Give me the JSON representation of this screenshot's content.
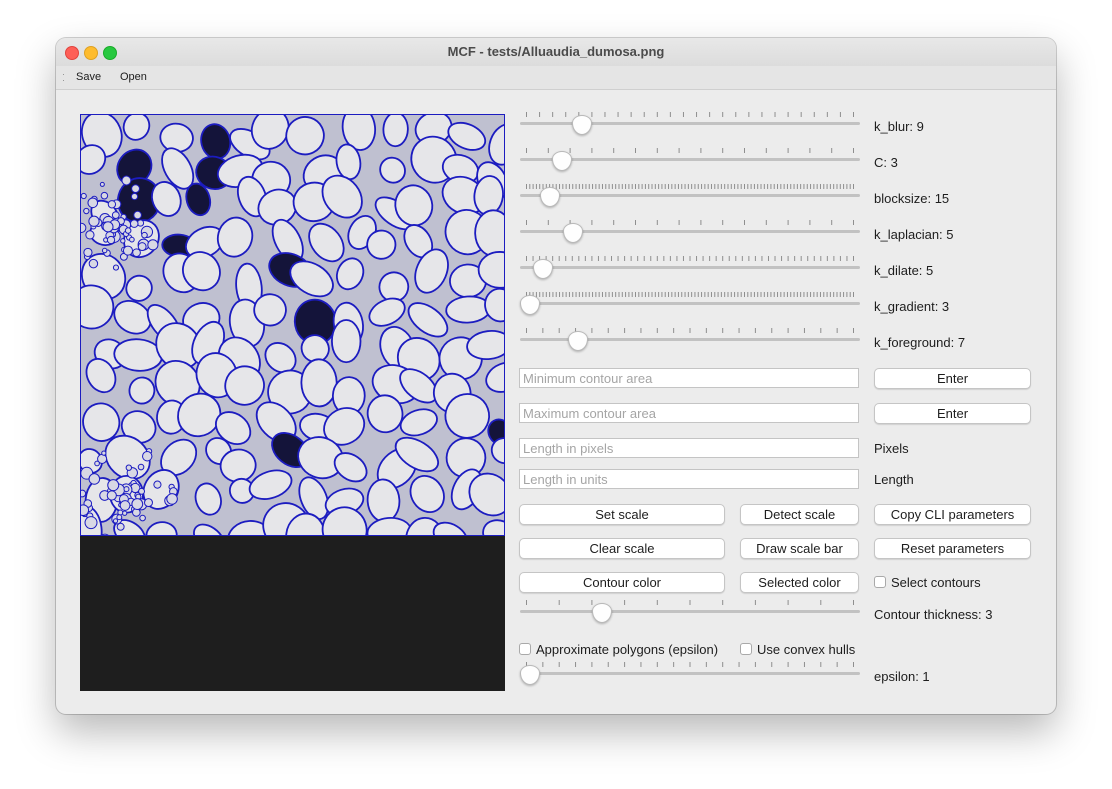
{
  "window": {
    "title": "MCF - tests/Alluaudia_dumosa.png"
  },
  "menu": [
    {
      "label": "Save"
    },
    {
      "label": "Open"
    }
  ],
  "sliders": [
    {
      "label": "k_blur: 9",
      "value": 9,
      "min": 1,
      "max": 51,
      "ticks": 25
    },
    {
      "label": "C: 3",
      "value": 3,
      "min": 0,
      "max": 30,
      "ticks": 15
    },
    {
      "label": "blocksize: 15",
      "value": 15,
      "min": 3,
      "max": 201,
      "ticks": 99
    },
    {
      "label": "k_laplacian: 5",
      "value": 5,
      "min": 1,
      "max": 31,
      "ticks": 15
    },
    {
      "label": "k_dilate: 5",
      "value": 5,
      "min": 1,
      "max": 101,
      "ticks": 50
    },
    {
      "label": "k_gradient: 3",
      "value": 3,
      "min": 3,
      "max": 201,
      "ticks": 99
    },
    {
      "label": "k_foreground: 7",
      "value": 7,
      "min": 1,
      "max": 41,
      "ticks": 20
    }
  ],
  "inputs": {
    "min_area_placeholder": "Minimum contour area",
    "max_area_placeholder": "Maximum contour area",
    "length_pixels_placeholder": "Length in pixels",
    "length_units_placeholder": "Length in units"
  },
  "buttons": {
    "enter_min": "Enter",
    "enter_max": "Enter",
    "set_scale": "Set scale",
    "detect_scale": "Detect scale",
    "copy_cli": "Copy CLI parameters",
    "clear_scale": "Clear scale",
    "draw_scale_bar": "Draw scale bar",
    "reset_parameters": "Reset parameters",
    "contour_color": "Contour color",
    "selected_color": "Selected color"
  },
  "labels": {
    "pixels": "Pixels",
    "length": "Length",
    "select_contours": "Select contours",
    "approximate_polygons": "Approximate polygons (epsilon)",
    "use_convex_hulls": "Use convex hulls"
  },
  "thickness_slider": {
    "label": "Contour thickness: 3",
    "value": 3,
    "min": 1,
    "max": 10,
    "ticks": 10
  },
  "epsilon_slider": {
    "label": "epsilon: 1",
    "value": 1,
    "min": 1,
    "max": 20,
    "ticks": 20
  },
  "checkboxes": {
    "select_contours": false,
    "approximate_polygons": false,
    "use_convex_hulls": false
  },
  "colors": {
    "contour": "#1c1cc0",
    "cell_fill": "#e6e6e9",
    "background": "#1e1e1e"
  }
}
